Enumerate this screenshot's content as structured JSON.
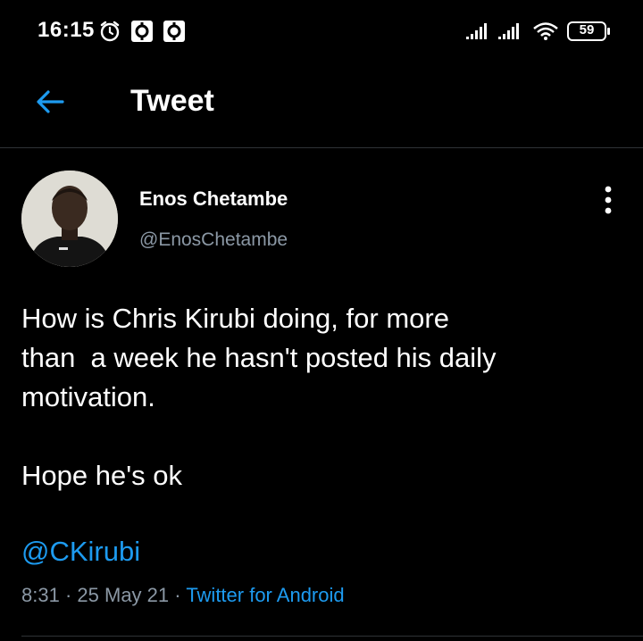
{
  "status_bar": {
    "time": "16:15",
    "battery": "59",
    "icons": [
      "alarm-icon",
      "notification-app-icon",
      "notification-app-icon",
      "signal-icon",
      "signal-icon",
      "wifi-icon",
      "battery-icon"
    ]
  },
  "header": {
    "title": "Tweet",
    "back_icon": "arrow-left-icon"
  },
  "tweet": {
    "author_name": "Enos Chetambe",
    "author_handle": "@EnosChetambe",
    "text_line1": "How is Chris Kirubi doing, for more",
    "text_line2": "than  a week he hasn't posted his daily",
    "text_line3": "motivation.",
    "text_para2": "Hope he's ok",
    "mention": "@CKirubi",
    "time": "8:31",
    "sep1": "·",
    "date": "25 May 21",
    "sep2": "·",
    "source": "Twitter for Android",
    "more_icon": "more-vertical-icon"
  },
  "colors": {
    "background": "#000000",
    "accent": "#1d9bf0",
    "secondary_text": "#8b98a5",
    "divider": "#2f3336"
  }
}
